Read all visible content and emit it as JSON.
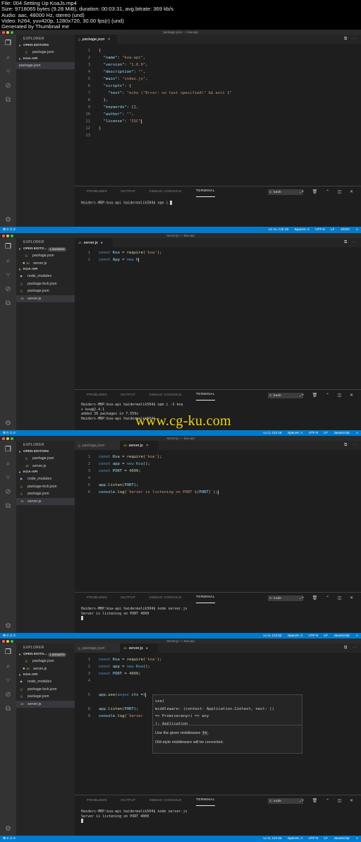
{
  "header": {
    "line1": "File: 004 Setting Up KoaJs.mp4",
    "line2": "Size: 9718065 bytes (9.28 MiB), duration: 00:03:31, avg.bitrate: 369 kb/s",
    "line3": "Audio: aac, 48000 Hz, stereo (und)",
    "line4": "Video: h264, yuv420p, 1280x720, 30.00 fps(r) (und)",
    "line5": "Generated by Thumbnail me"
  },
  "common": {
    "explorer": "EXPLORER",
    "open_editors": "OPEN EDITORS",
    "open_editors_short": "OPEN EDITO...",
    "unsaved_badge": "1 UNSAVED",
    "koa_api": "KOA-API",
    "problems": "PROBLEMS",
    "output": "OUTPUT",
    "debug_console": "DEBUG CONSOLE",
    "terminal": "TERMINAL",
    "package_json": "package.json",
    "server_js": "server.js",
    "node_modules": "node_modules",
    "package_lock": "package-lock.json",
    "status_errors": "⊗ 0 ⚠ 0",
    "utf8": "UTF-8",
    "lf": "LF",
    "json": "JSON",
    "javascript": "JavaScript"
  },
  "frame1": {
    "window_title": "package.json — koa-api",
    "code": [
      "{",
      "  \"name\": \"koa-api\",",
      "  \"version\": \"1.0.0\",",
      "  \"description\": \"\",",
      "  \"main\": \"index.js\",",
      "  \"scripts\": {",
      "    \"test\": \"echo \\\"Error: no test specified\\\" && exit 1\"",
      "  },",
      "  \"keywords\": [],",
      "  \"author\": \"\",",
      "  \"license\": \"ISC\"",
      "}",
      ""
    ],
    "terminal_select": "1: bash",
    "terminal_lines": [
      "Haiders-MBP:koa-api haidermalik504$ npm i "
    ],
    "status_position": "Ln 11, Col 19",
    "status_spaces": "Spaces: 2"
  },
  "frame2": {
    "window_title": "server.js — koa-api",
    "code": [
      "const Koa = require('koa');",
      "const App = new K"
    ],
    "terminal_select": "1: bash",
    "terminal_lines": [
      "Haiders-MBP:koa-api haidermalik504$ npm i -S koa",
      "+ koa@2.4.1",
      "added 38 packages in 7.559s",
      "Haiders-MBP:koa-api haidermalik504$ "
    ],
    "status_position": "Ln 2, Col 18",
    "status_spaces": "Spaces: 4"
  },
  "frame3": {
    "window_title": "server.js — koa-api",
    "code": [
      "const Koa = require('koa');",
      "const app = new Koa();",
      "const PORT = 4000;",
      "",
      "app.listen(PORT);",
      "console.log(`Server is listening on PORT ${PORT}`);"
    ],
    "terminal_select": "1: node",
    "terminal_lines": [
      "Haiders-MBP:koa-api haidermalik504$ node server.js",
      "Server is listening on PORT 4000",
      ""
    ],
    "status_position": "Ln 6, Col 52",
    "status_spaces": "Spaces: 4"
  },
  "frame4": {
    "window_title": "server.js — koa-api",
    "code": [
      "const Koa = require('koa');",
      "const app = new Koa();",
      "const PORT = 4000;",
      "",
      "",
      "app.use(async ctx =)",
      "",
      "app.listen(PORT);",
      "console.log(`Server"
    ],
    "tooltip": {
      "sig1": "use(",
      "sig2": "middleware: (context: Application.Context, next: ()",
      "sig3": "=> Promise<any>) => any",
      "sig4": "): Application",
      "doc1_a": "Use the given middleware ",
      "doc1_code": "fn",
      "doc1_b": ".",
      "doc2": "Old-style middleware will be converted."
    },
    "terminal_select": "1: node",
    "terminal_lines": [
      "Haiders-MBP:koa-api haidermalik504$ node server.js",
      "Server is listening on PORT 4000",
      ""
    ],
    "status_position": "Ln 6, Col 20",
    "status_spaces": "Spaces: 4"
  },
  "watermark": "www.cg-ku.com"
}
